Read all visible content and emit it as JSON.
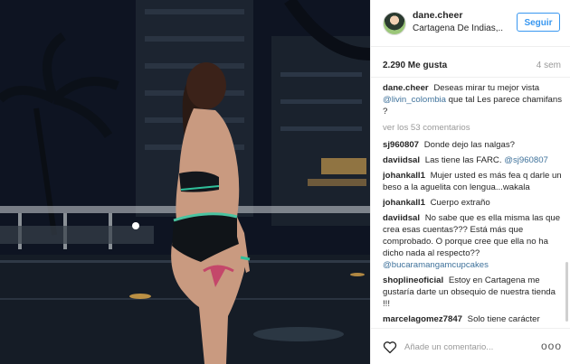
{
  "post": {
    "username": "dane.cheer",
    "location": "Cartagena De Indias,...",
    "follow_label": "Seguir",
    "likes": "2.290 Me gusta",
    "age": "4 sem",
    "caption": {
      "user": "dane.cheer",
      "text_before": "Deseas mirar tu mejor vista",
      "mention": "@livin_colombia",
      "text_after": "que tal Les parece chamifans ?"
    },
    "view_more": "ver los 53 comentarios",
    "comments": [
      {
        "user": "sj960807",
        "text": "Donde dejo las nalgas?"
      },
      {
        "user": "daviidsal",
        "text": "Las tiene las FARC.",
        "mention": "@sj960807"
      },
      {
        "user": "johankall1",
        "text": "Mujer usted es más fea q darle un beso a la aguelita con lengua...wakala"
      },
      {
        "user": "johankall1",
        "text": "Cuerpo extraño"
      },
      {
        "user": "daviidsal",
        "text": "No sabe que es ella misma las que crea esas cuentas??? Está más que comprobado. O porque cree que ella no ha dicho nada al respecto??",
        "mention": "@bucaramangamcupcakes"
      },
      {
        "user": "shoplineoficial",
        "text": "Estoy en Cartagena me gustaría darte un obsequio de nuestra tienda !!!"
      },
      {
        "user": "marcelagomez7847",
        "text": "Solo tiene carácter"
      }
    ],
    "add_comment_placeholder": "Añade un comentario...",
    "more_options": "ooo"
  },
  "icons": {
    "heart": "heart-outline-icon",
    "options": "more-options-icon"
  },
  "colors": {
    "accent": "#3897f0",
    "link": "#3f729b",
    "muted": "#999999"
  }
}
